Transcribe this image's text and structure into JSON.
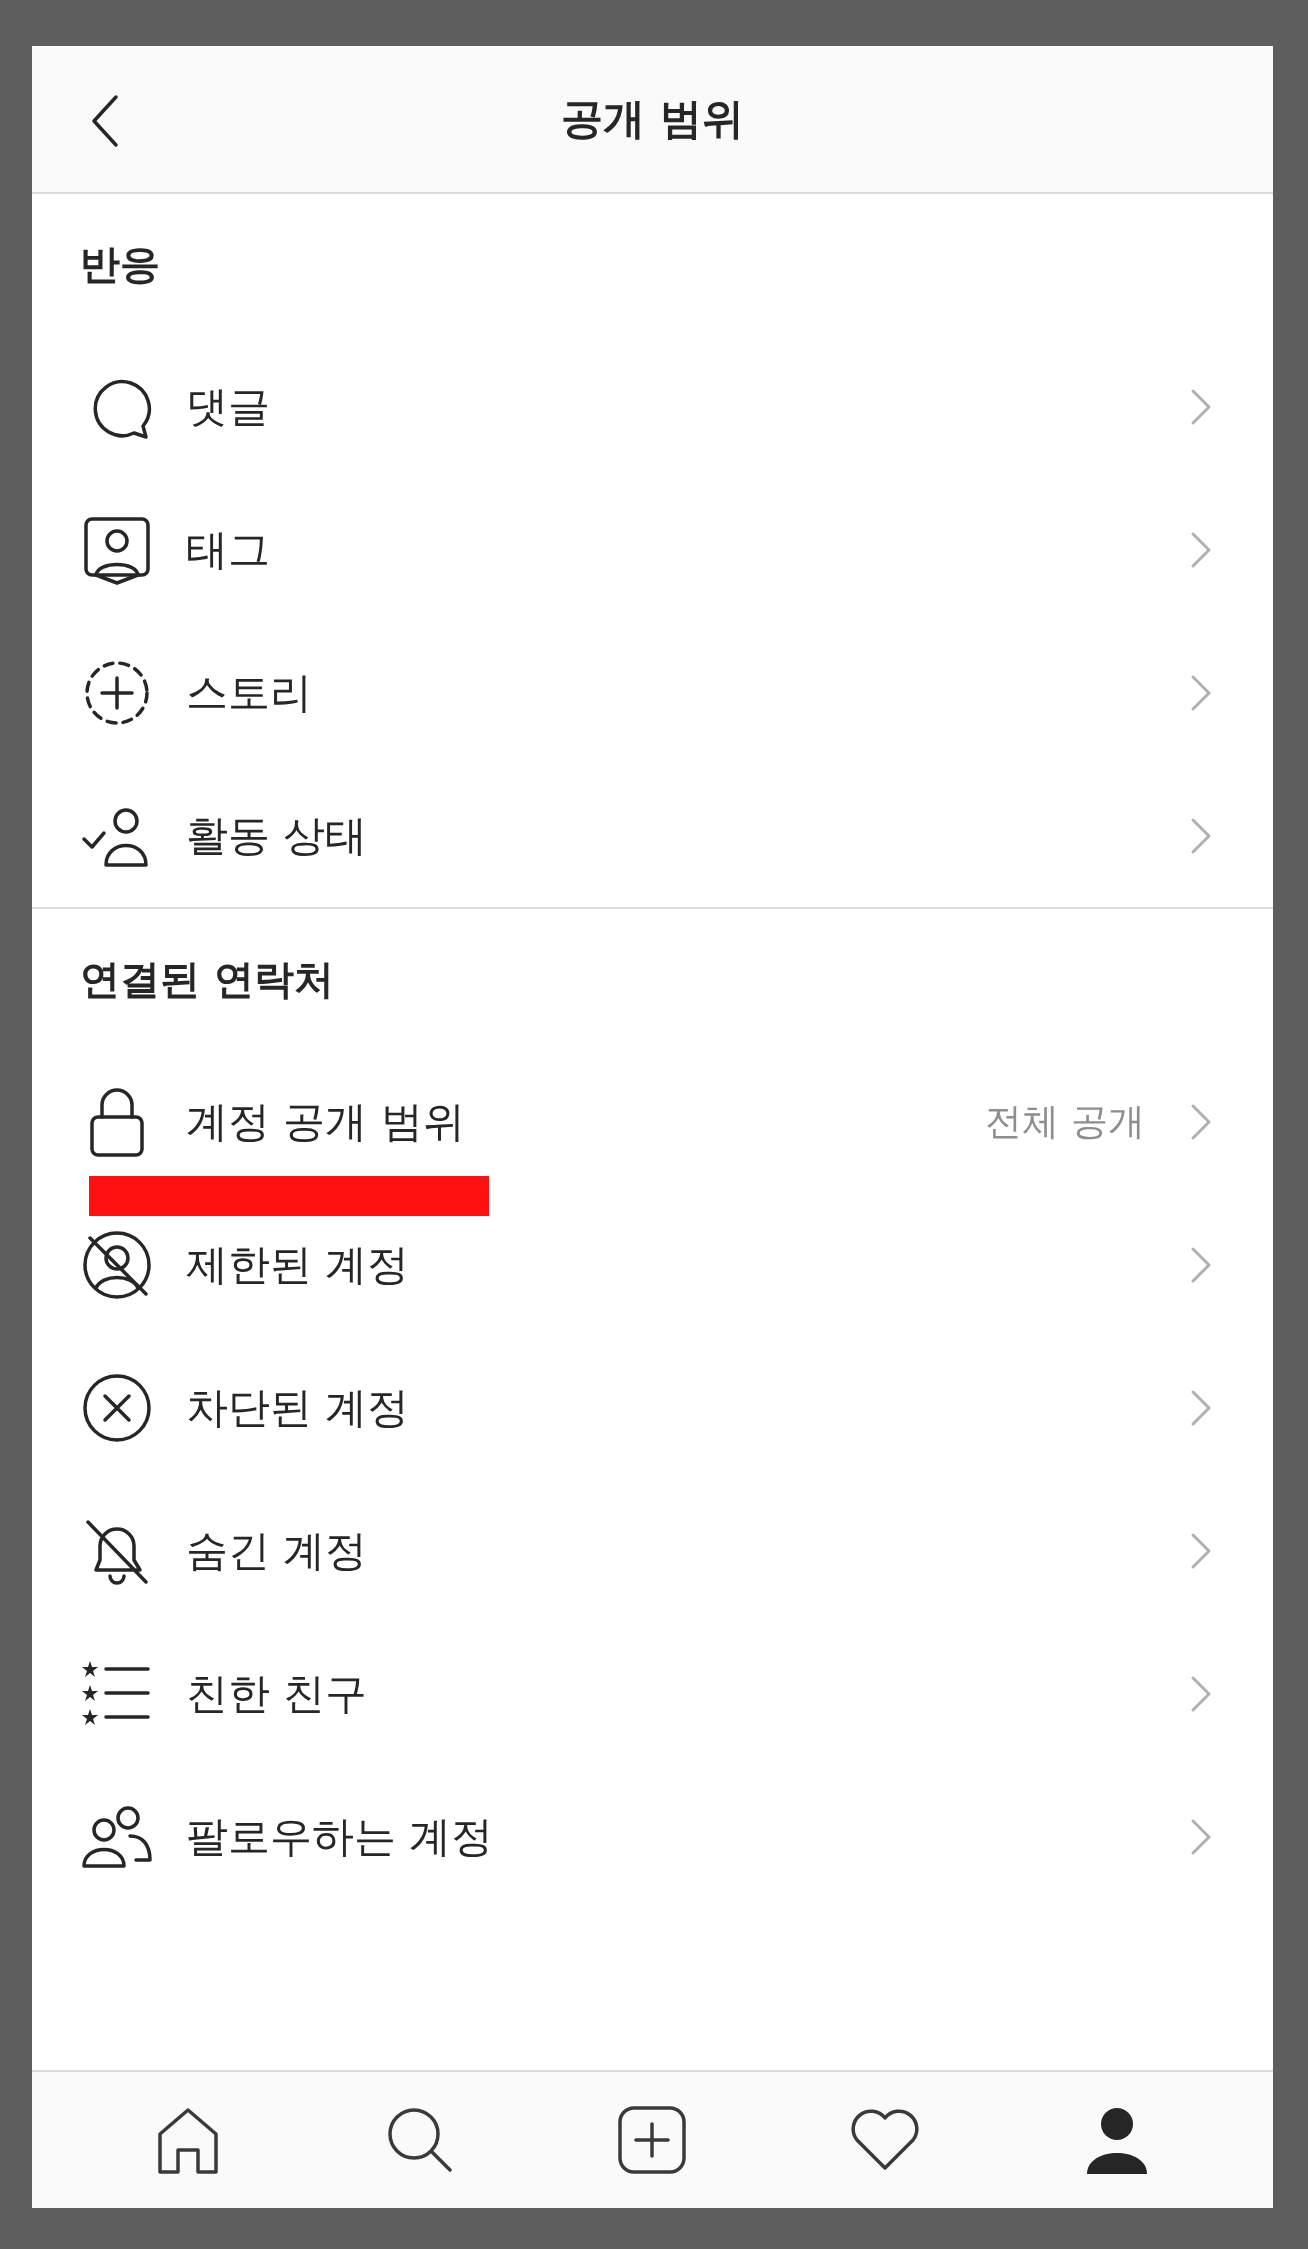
{
  "header": {
    "title": "공개 범위"
  },
  "sections": [
    {
      "title": "반응",
      "items": [
        {
          "label": "댓글"
        },
        {
          "label": "태그"
        },
        {
          "label": "스토리"
        },
        {
          "label": "활동 상태"
        }
      ]
    },
    {
      "title": "연결된 연락처",
      "items": [
        {
          "label": "계정 공개 범위",
          "value": "전체 공개",
          "highlighted": true
        },
        {
          "label": "제한된 계정"
        },
        {
          "label": "차단된 계정"
        },
        {
          "label": "숨긴 계정"
        },
        {
          "label": "친한 친구"
        },
        {
          "label": "팔로우하는 계정"
        }
      ]
    }
  ],
  "tab_bar": [
    {
      "selected": false
    },
    {
      "selected": false
    },
    {
      "selected": false
    },
    {
      "selected": false
    },
    {
      "selected": true
    }
  ]
}
